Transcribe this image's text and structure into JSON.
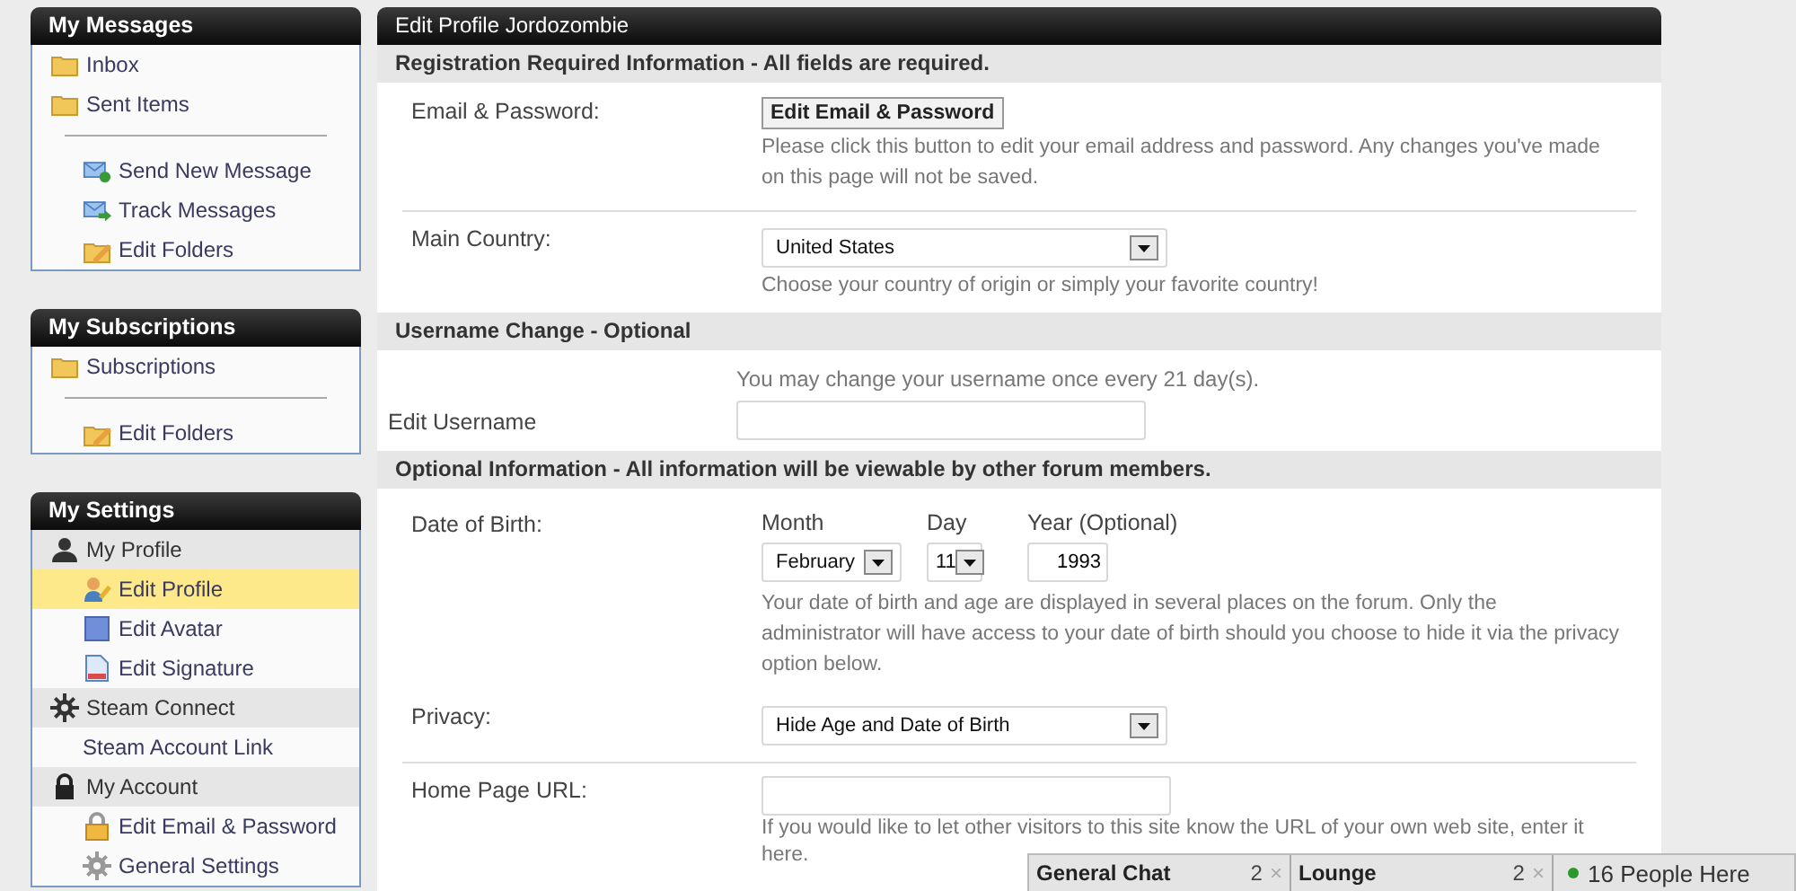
{
  "sidebar": [
    {
      "title": "My Messages",
      "items": [
        {
          "kind": "folder",
          "label": "Inbox",
          "selected": false
        },
        {
          "kind": "folder",
          "label": "Sent Items",
          "selected": false
        },
        {
          "kind": "divider"
        },
        {
          "kind": "new-message",
          "label": "Send New Message",
          "selected": false
        },
        {
          "kind": "track",
          "label": "Track Messages",
          "selected": false
        },
        {
          "kind": "edit-folders",
          "label": "Edit Folders",
          "selected": false
        }
      ]
    },
    {
      "title": "My Subscriptions",
      "items": [
        {
          "kind": "folder",
          "label": "Subscriptions",
          "selected": false
        },
        {
          "kind": "divider"
        },
        {
          "kind": "edit-folders",
          "label": "Edit Folders",
          "selected": false
        }
      ]
    },
    {
      "title": "My Settings",
      "items": [
        {
          "kind": "group-user",
          "label": "My Profile",
          "selected": false
        },
        {
          "kind": "edit-profile",
          "label": "Edit Profile",
          "selected": true
        },
        {
          "kind": "avatar",
          "label": "Edit Avatar",
          "selected": false
        },
        {
          "kind": "signature",
          "label": "Edit Signature",
          "selected": false
        },
        {
          "kind": "group-gear",
          "label": "Steam Connect",
          "selected": false
        },
        {
          "kind": "link",
          "label": "Steam Account Link",
          "selected": false
        },
        {
          "kind": "group-lock",
          "label": "My Account",
          "selected": false
        },
        {
          "kind": "edit-email",
          "label": "Edit Email & Password",
          "selected": false
        },
        {
          "kind": "settings",
          "label": "General Settings",
          "selected": false
        }
      ]
    }
  ],
  "main": {
    "title": "Edit Profile Jordozombie",
    "sections": [
      {
        "title": "Registration Required Information - All fields are required.",
        "rows": [
          {
            "kind": "button",
            "label": "Email & Password:",
            "button": "Edit Email & Password",
            "help": "Please click this button to edit your email address and password. Any changes you've made on this page will not be saved."
          },
          {
            "kind": "select",
            "separated": true,
            "label": "Main Country:",
            "value": "United States",
            "help": "Choose your country of origin or simply your favorite country!"
          }
        ]
      },
      {
        "title": "Username Change - Optional",
        "rows": [
          {
            "kind": "username",
            "label": "Edit Username",
            "note": "You may change your username once every 21 day(s)."
          }
        ]
      },
      {
        "title": "Optional Information - All information will be viewable by other forum members.",
        "rows": [
          {
            "kind": "date",
            "label": "Date of Birth:",
            "month": {
              "label": "Month",
              "value": "February"
            },
            "day": {
              "label": "Day",
              "value": "11"
            },
            "year": {
              "label": "Year (Optional)",
              "value": "1993"
            },
            "help": "Your date of birth and age are displayed in several places on the forum. Only the administrator will have access to your date of birth should you choose to hide it via the privacy option below."
          },
          {
            "kind": "select",
            "label": "Privacy:",
            "value": "Hide Age and Date of Birth"
          },
          {
            "kind": "text",
            "separated": true,
            "label": "Home Page URL:",
            "help": "If you would like to let other visitors to this site know the URL of your own web site, enter it here."
          }
        ]
      }
    ]
  },
  "chat_bar": {
    "tabs": [
      {
        "label": "General Chat",
        "count": "2",
        "close": "×"
      },
      {
        "label": "Lounge",
        "count": "2",
        "close": "×"
      }
    ],
    "online": "16 People Here"
  }
}
